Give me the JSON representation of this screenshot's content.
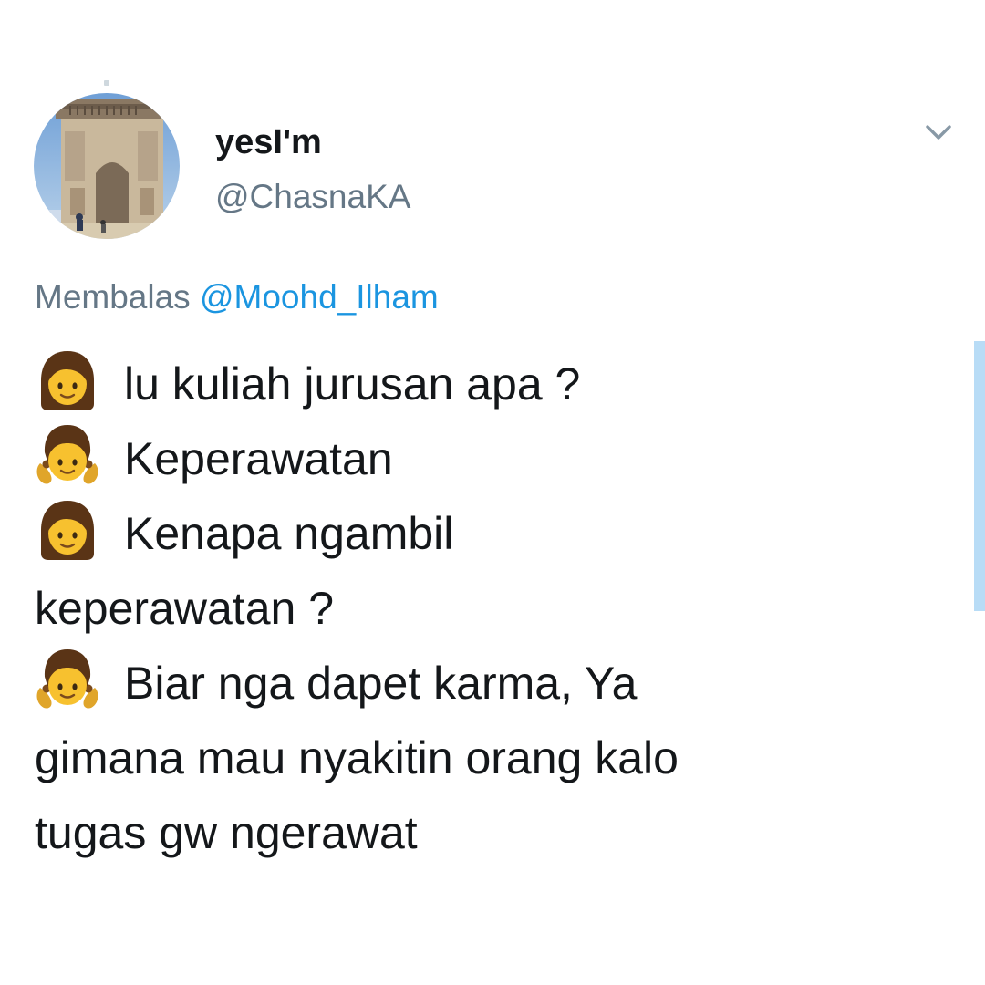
{
  "tweet": {
    "display_name": "yesI'm",
    "handle": "@ChasnaKA",
    "reply_prefix": "Membalas",
    "reply_mention": "@Moohd_Ilham",
    "lines": [
      {
        "emoji": "woman-emoji",
        "text": "lu kuliah jurusan apa ?"
      },
      {
        "emoji": "girl-emoji",
        "text": "Keperawatan"
      },
      {
        "emoji": "woman-emoji",
        "text": "Kenapa ngambil"
      },
      {
        "emoji": "",
        "text": "keperawatan ?"
      },
      {
        "emoji": "girl-emoji",
        "text": "Biar nga dapet karma, Ya"
      },
      {
        "emoji": "",
        "text": "gimana mau nyakitin orang kalo"
      },
      {
        "emoji": "",
        "text": "tugas gw ngerawat"
      }
    ],
    "menu_icon": "chevron-down-icon"
  },
  "colors": {
    "text": "#14171a",
    "secondary": "#657786",
    "link": "#1b95e0"
  }
}
